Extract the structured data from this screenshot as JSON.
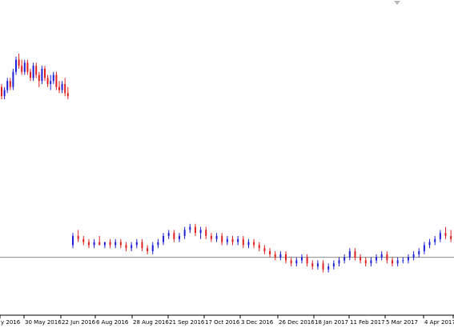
{
  "chart_data": {
    "type": "candlestick",
    "xlabel": "",
    "ylabel": "",
    "grid": false,
    "colors": {
      "bull": "#1f1fd6",
      "bear": "#e01f1f",
      "level_line": "#8a8a8a",
      "axis": "#000000"
    },
    "x_tick_labels": [
      "y 2016",
      "30 May 2016",
      "22 Jun 2016",
      "6 Aug 2016",
      "28 Aug 2016",
      "21 Sep 2016",
      "17 Oct 2016",
      "3 Dec 2016",
      "26 Dec 2016",
      "18 Jan 2017",
      "11 Feb 2017",
      "5 Mar 2017",
      "4 Apr 2017"
    ],
    "price_range": [
      0,
      100
    ],
    "horizontal_level": 18,
    "segments": [
      {
        "name": "segment-1",
        "ohlc": [
          [
            74,
            75,
            70,
            71
          ],
          [
            71,
            74,
            70,
            73
          ],
          [
            73,
            77,
            72,
            76
          ],
          [
            76,
            77,
            73,
            74
          ],
          [
            74,
            80,
            73,
            79
          ],
          [
            79,
            84,
            78,
            83
          ],
          [
            83,
            85,
            80,
            81
          ],
          [
            81,
            83,
            78,
            79
          ],
          [
            79,
            83,
            78,
            82
          ],
          [
            82,
            83,
            78,
            79
          ],
          [
            79,
            80,
            76,
            77
          ],
          [
            77,
            82,
            76,
            81
          ],
          [
            81,
            82,
            77,
            78
          ],
          [
            78,
            79,
            74,
            76
          ],
          [
            76,
            81,
            75,
            80
          ],
          [
            80,
            81,
            76,
            77
          ],
          [
            77,
            78,
            74,
            75
          ],
          [
            75,
            78,
            73,
            76
          ],
          [
            76,
            79,
            75,
            78
          ],
          [
            78,
            79,
            73,
            74
          ],
          [
            74,
            76,
            72,
            73
          ],
          [
            73,
            76,
            72,
            75
          ],
          [
            75,
            77,
            71,
            72
          ],
          [
            72,
            74,
            70,
            71
          ]
        ]
      },
      {
        "name": "segment-2",
        "ohlc": [
          [
            22,
            26,
            21,
            25
          ],
          [
            25,
            27,
            23,
            24
          ],
          [
            24,
            25,
            22,
            23
          ],
          [
            23,
            24,
            21,
            22
          ],
          [
            22,
            24,
            21,
            23
          ],
          [
            23,
            25,
            22,
            22
          ],
          [
            22,
            23,
            21,
            23
          ],
          [
            23,
            24,
            21,
            22
          ],
          [
            22,
            24,
            21,
            23
          ],
          [
            23,
            24,
            21,
            22
          ],
          [
            22,
            23,
            20,
            21
          ],
          [
            21,
            23,
            20,
            22
          ],
          [
            22,
            24,
            21,
            23
          ],
          [
            23,
            24,
            20,
            21
          ],
          [
            21,
            22,
            19,
            20
          ],
          [
            20,
            23,
            19,
            22
          ],
          [
            22,
            24,
            21,
            23
          ],
          [
            23,
            26,
            22,
            25
          ],
          [
            25,
            27,
            24,
            26
          ],
          [
            26,
            27,
            23,
            24
          ],
          [
            24,
            26,
            23,
            25
          ],
          [
            25,
            28,
            24,
            27
          ],
          [
            27,
            29,
            26,
            28
          ],
          [
            28,
            29,
            25,
            26
          ],
          [
            26,
            28,
            24,
            27
          ],
          [
            27,
            28,
            24,
            25
          ],
          [
            25,
            26,
            23,
            24
          ],
          [
            24,
            26,
            23,
            25
          ],
          [
            25,
            26,
            22,
            23
          ],
          [
            23,
            25,
            22,
            24
          ],
          [
            24,
            25,
            22,
            23
          ],
          [
            23,
            25,
            22,
            24
          ],
          [
            24,
            25,
            21,
            22
          ],
          [
            22,
            24,
            21,
            23
          ],
          [
            23,
            24,
            21,
            22
          ],
          [
            22,
            23,
            20,
            21
          ],
          [
            21,
            22,
            19,
            20
          ],
          [
            20,
            21,
            18,
            19
          ],
          [
            19,
            20,
            17,
            18
          ],
          [
            18,
            20,
            17,
            19
          ],
          [
            19,
            20,
            16,
            17
          ],
          [
            17,
            18,
            15,
            16
          ],
          [
            16,
            18,
            15,
            17
          ],
          [
            17,
            19,
            16,
            18
          ],
          [
            18,
            19,
            15,
            16
          ],
          [
            16,
            17,
            14,
            15
          ],
          [
            15,
            17,
            14,
            16
          ],
          [
            16,
            17,
            13,
            14
          ],
          [
            14,
            16,
            13,
            15
          ],
          [
            15,
            17,
            14,
            16
          ],
          [
            16,
            18,
            15,
            17
          ],
          [
            17,
            19,
            16,
            18
          ],
          [
            18,
            21,
            17,
            20
          ],
          [
            20,
            21,
            17,
            18
          ],
          [
            18,
            19,
            16,
            17
          ],
          [
            17,
            18,
            15,
            16
          ],
          [
            16,
            18,
            15,
            17
          ],
          [
            17,
            19,
            16,
            18
          ],
          [
            18,
            20,
            17,
            19
          ],
          [
            19,
            20,
            16,
            17
          ],
          [
            17,
            18,
            15,
            16
          ],
          [
            16,
            18,
            15,
            17
          ],
          [
            17,
            18,
            16,
            17
          ],
          [
            17,
            19,
            16,
            18
          ],
          [
            18,
            20,
            17,
            19
          ],
          [
            19,
            21,
            18,
            20
          ],
          [
            20,
            23,
            19,
            22
          ],
          [
            22,
            24,
            21,
            23
          ],
          [
            23,
            25,
            22,
            24
          ],
          [
            24,
            27,
            23,
            26
          ],
          [
            26,
            28,
            24,
            25
          ],
          [
            25,
            27,
            23,
            24
          ],
          [
            24,
            26,
            23,
            25
          ],
          [
            25,
            26,
            22,
            23
          ]
        ]
      }
    ]
  }
}
